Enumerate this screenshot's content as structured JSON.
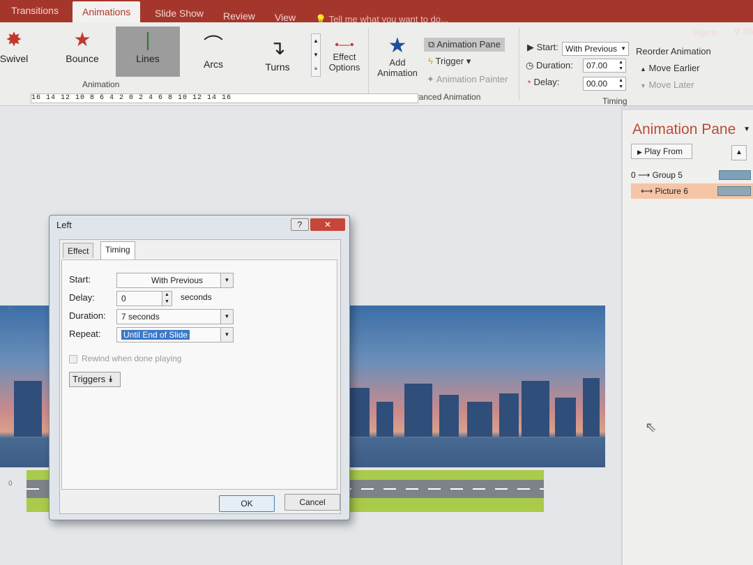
{
  "tabs": [
    "Transitions",
    "Animations",
    "Slide Show",
    "Review",
    "View"
  ],
  "tell_me": "Tell me what you want to do...",
  "sign_in": "Sign in",
  "share": "Sh",
  "animation_gallery": [
    {
      "label": "Swivel",
      "icon": "swivel-icon"
    },
    {
      "label": "Bounce",
      "icon": "bounce-icon"
    },
    {
      "label": "Lines",
      "icon": "lines-icon",
      "selected": true
    },
    {
      "label": "Arcs",
      "icon": "arcs-icon"
    },
    {
      "label": "Turns",
      "icon": "turns-icon"
    }
  ],
  "effect_options": {
    "line1": "Effect",
    "line2": "Options"
  },
  "group_animation": "Animation",
  "add_animation": {
    "line1": "Add",
    "line2": "Animation"
  },
  "animation_pane_btn": "Animation Pane",
  "trigger_btn": "Trigger",
  "animation_painter": "Animation Painter",
  "group_advanced": "Advanced Animation",
  "timing": {
    "start_label": "Start:",
    "start_value": "With Previous",
    "duration_label": "Duration:",
    "duration_value": "07.00",
    "delay_label": "Delay:",
    "delay_value": "00.00",
    "group_label": "Timing"
  },
  "reorder": {
    "title": "Reorder Animation",
    "earlier": "Move Earlier",
    "later": "Move Later"
  },
  "ruler_text": "16 14 12 10 8 6 4 2 0 2 4 6 8 10 12 14 16",
  "animation_pane": {
    "title": "Animation Pane",
    "play_from": "Play From",
    "items": [
      {
        "prefix": "0",
        "label": "Group 5"
      },
      {
        "prefix": "",
        "label": "Picture 6",
        "selected": true
      }
    ]
  },
  "dialog": {
    "title": "Left",
    "help": "?",
    "tabs": [
      "Effect",
      "Timing"
    ],
    "start_label": "Start:",
    "start_value": "With Previous",
    "delay_label": "Delay:",
    "delay_value": "0",
    "delay_unit": "seconds",
    "duration_label": "Duration:",
    "duration_value": "7 seconds",
    "repeat_label": "Repeat:",
    "repeat_value": "Until End of Slide",
    "rewind_label": "Rewind when done playing",
    "triggers_label": "Triggers",
    "ok": "OK",
    "cancel": "Cancel"
  },
  "slide_marker": "0"
}
